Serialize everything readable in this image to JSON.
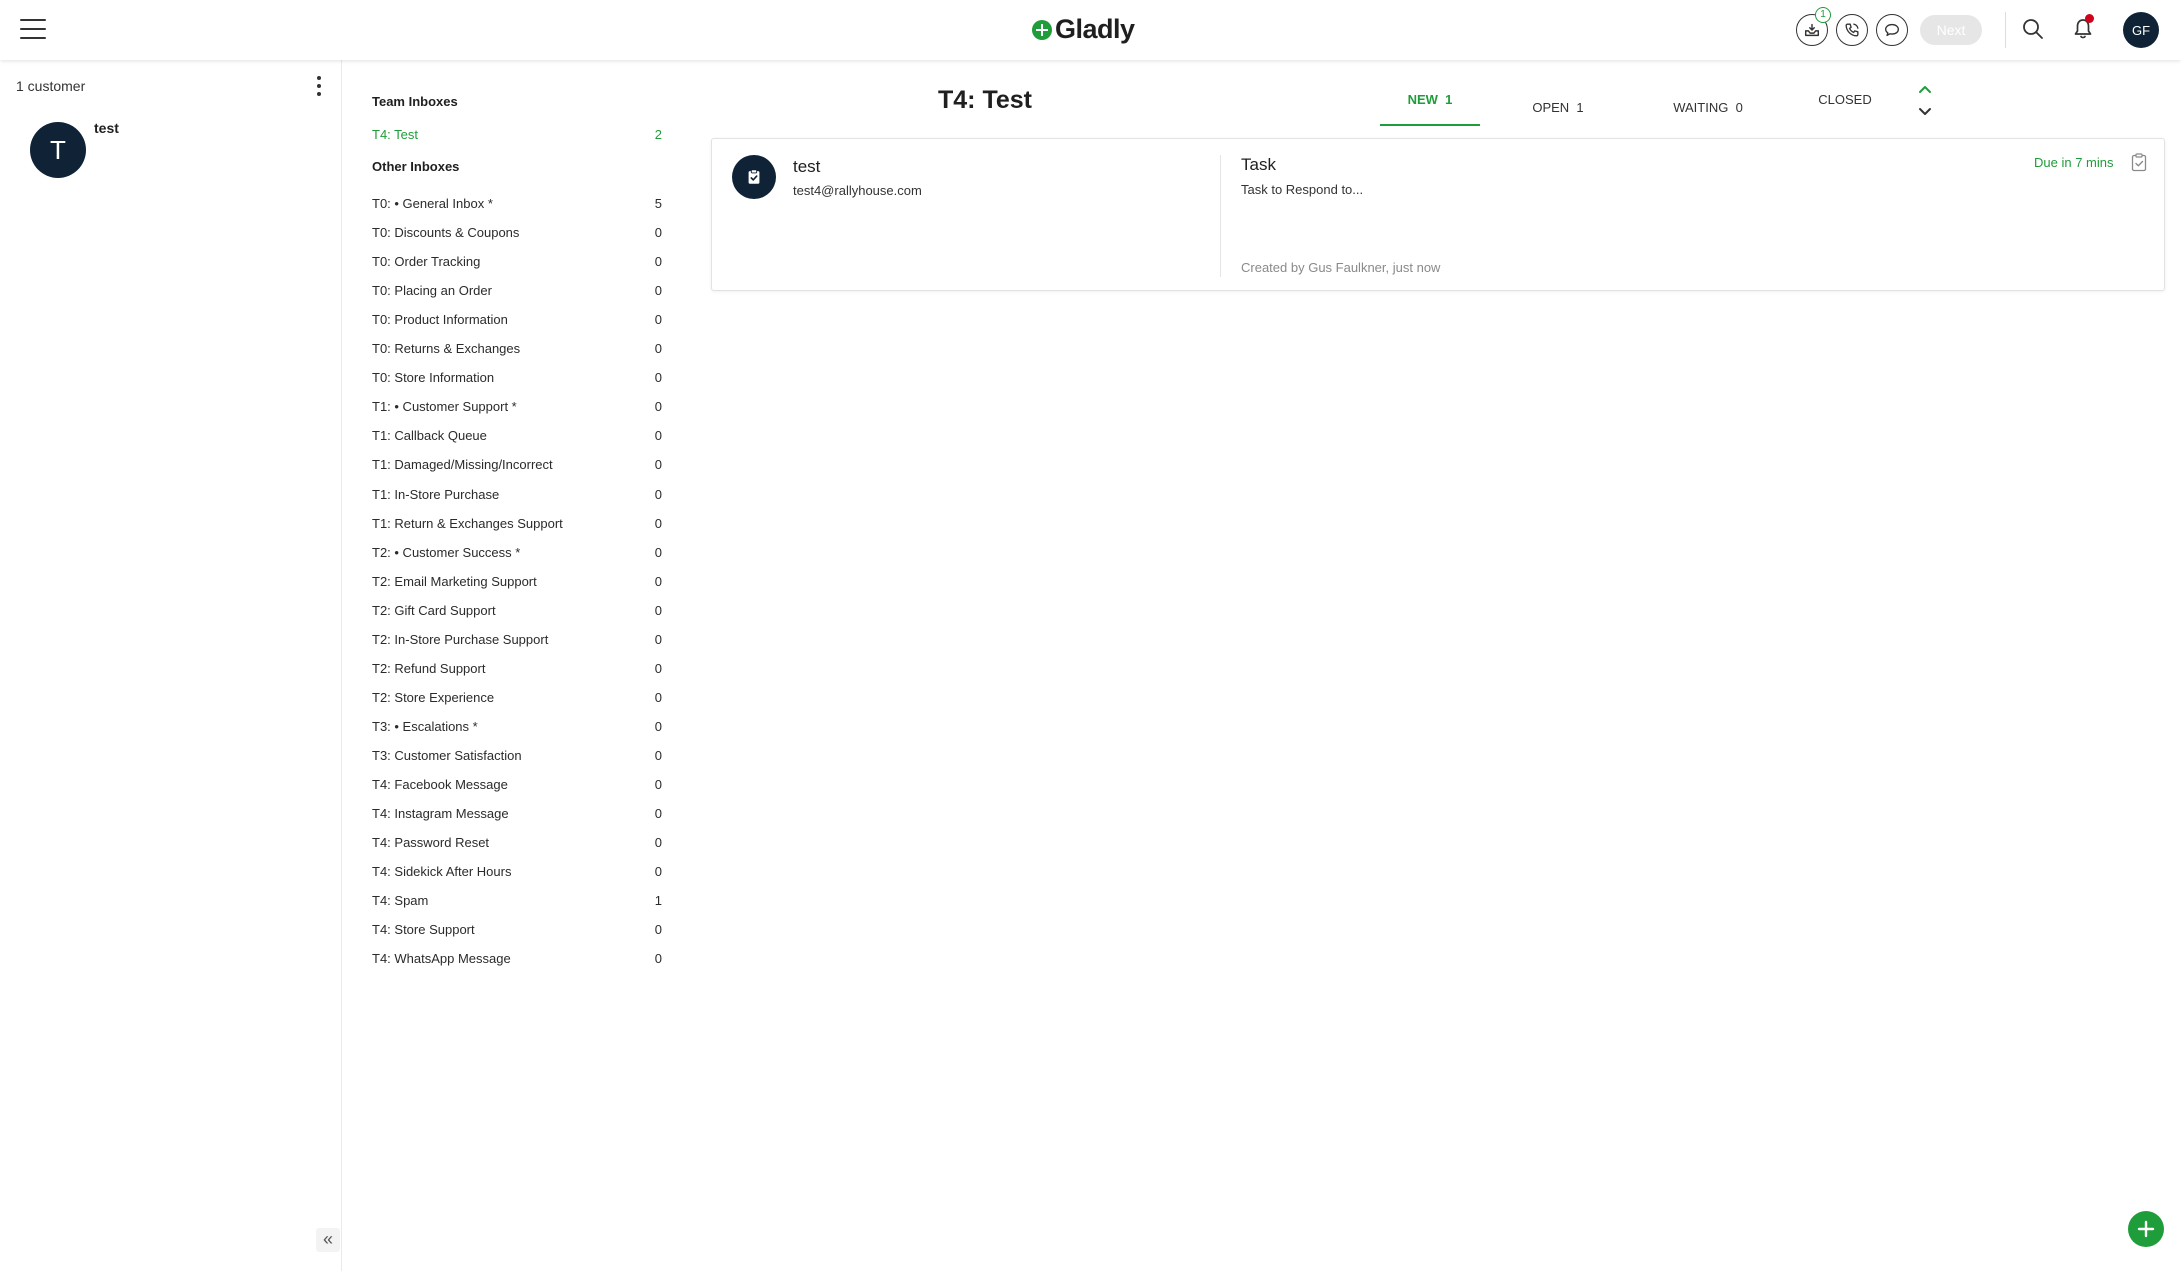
{
  "header": {
    "brand": "Gladly",
    "inbox_badge": "1",
    "next_label": "Next",
    "user_initials": "GF"
  },
  "customers": {
    "count_label": "1 customer",
    "list": [
      {
        "initial": "T",
        "name": "test"
      }
    ]
  },
  "inboxes": {
    "team_heading": "Team Inboxes",
    "team": [
      {
        "label": "T4: Test",
        "count": "2"
      }
    ],
    "other_heading": "Other Inboxes",
    "other": [
      {
        "label": "T0: • General Inbox *",
        "count": "5"
      },
      {
        "label": "T0: Discounts & Coupons",
        "count": "0"
      },
      {
        "label": "T0: Order Tracking",
        "count": "0"
      },
      {
        "label": "T0: Placing an Order",
        "count": "0"
      },
      {
        "label": "T0: Product Information",
        "count": "0"
      },
      {
        "label": "T0: Returns & Exchanges",
        "count": "0"
      },
      {
        "label": "T0: Store Information",
        "count": "0"
      },
      {
        "label": "T1: • Customer Support *",
        "count": "0"
      },
      {
        "label": "T1: Callback Queue",
        "count": "0"
      },
      {
        "label": "T1: Damaged/Missing/Incorrect",
        "count": "0"
      },
      {
        "label": "T1: In-Store Purchase",
        "count": "0"
      },
      {
        "label": "T1: Return & Exchanges Support",
        "count": "0"
      },
      {
        "label": "T2: • Customer Success *",
        "count": "0"
      },
      {
        "label": "T2: Email Marketing Support",
        "count": "0"
      },
      {
        "label": "T2: Gift Card Support",
        "count": "0"
      },
      {
        "label": "T2: In-Store Purchase Support",
        "count": "0"
      },
      {
        "label": "T2: Refund Support",
        "count": "0"
      },
      {
        "label": "T2: Store Experience",
        "count": "0"
      },
      {
        "label": "T3: • Escalations *",
        "count": "0"
      },
      {
        "label": "T3: Customer Satisfaction",
        "count": "0"
      },
      {
        "label": "T4: Facebook Message",
        "count": "0"
      },
      {
        "label": "T4: Instagram Message",
        "count": "0"
      },
      {
        "label": "T4: Password Reset",
        "count": "0"
      },
      {
        "label": "T4: Sidekick After Hours",
        "count": "0"
      },
      {
        "label": "T4: Spam",
        "count": "1"
      },
      {
        "label": "T4: Store Support",
        "count": "0"
      },
      {
        "label": "T4: WhatsApp Message",
        "count": "0"
      }
    ]
  },
  "main": {
    "title": "T4: Test",
    "tabs": [
      {
        "label": "NEW",
        "count": "1",
        "active": true
      },
      {
        "label": "OPEN",
        "count": "1",
        "active": false
      },
      {
        "label": "WAITING",
        "count": "0",
        "active": false
      },
      {
        "label": "CLOSED",
        "count": "",
        "active": false
      }
    ],
    "card": {
      "customer_name": "test",
      "customer_email": "test4@rallyhouse.com",
      "type": "Task",
      "description": "Task to Respond to...",
      "created": "Created by Gus Faulkner, just now",
      "due": "Due in 7 mins"
    }
  },
  "colors": {
    "accent": "#1f9d3a",
    "navy": "#0f2236",
    "alert": "#d0021b"
  }
}
